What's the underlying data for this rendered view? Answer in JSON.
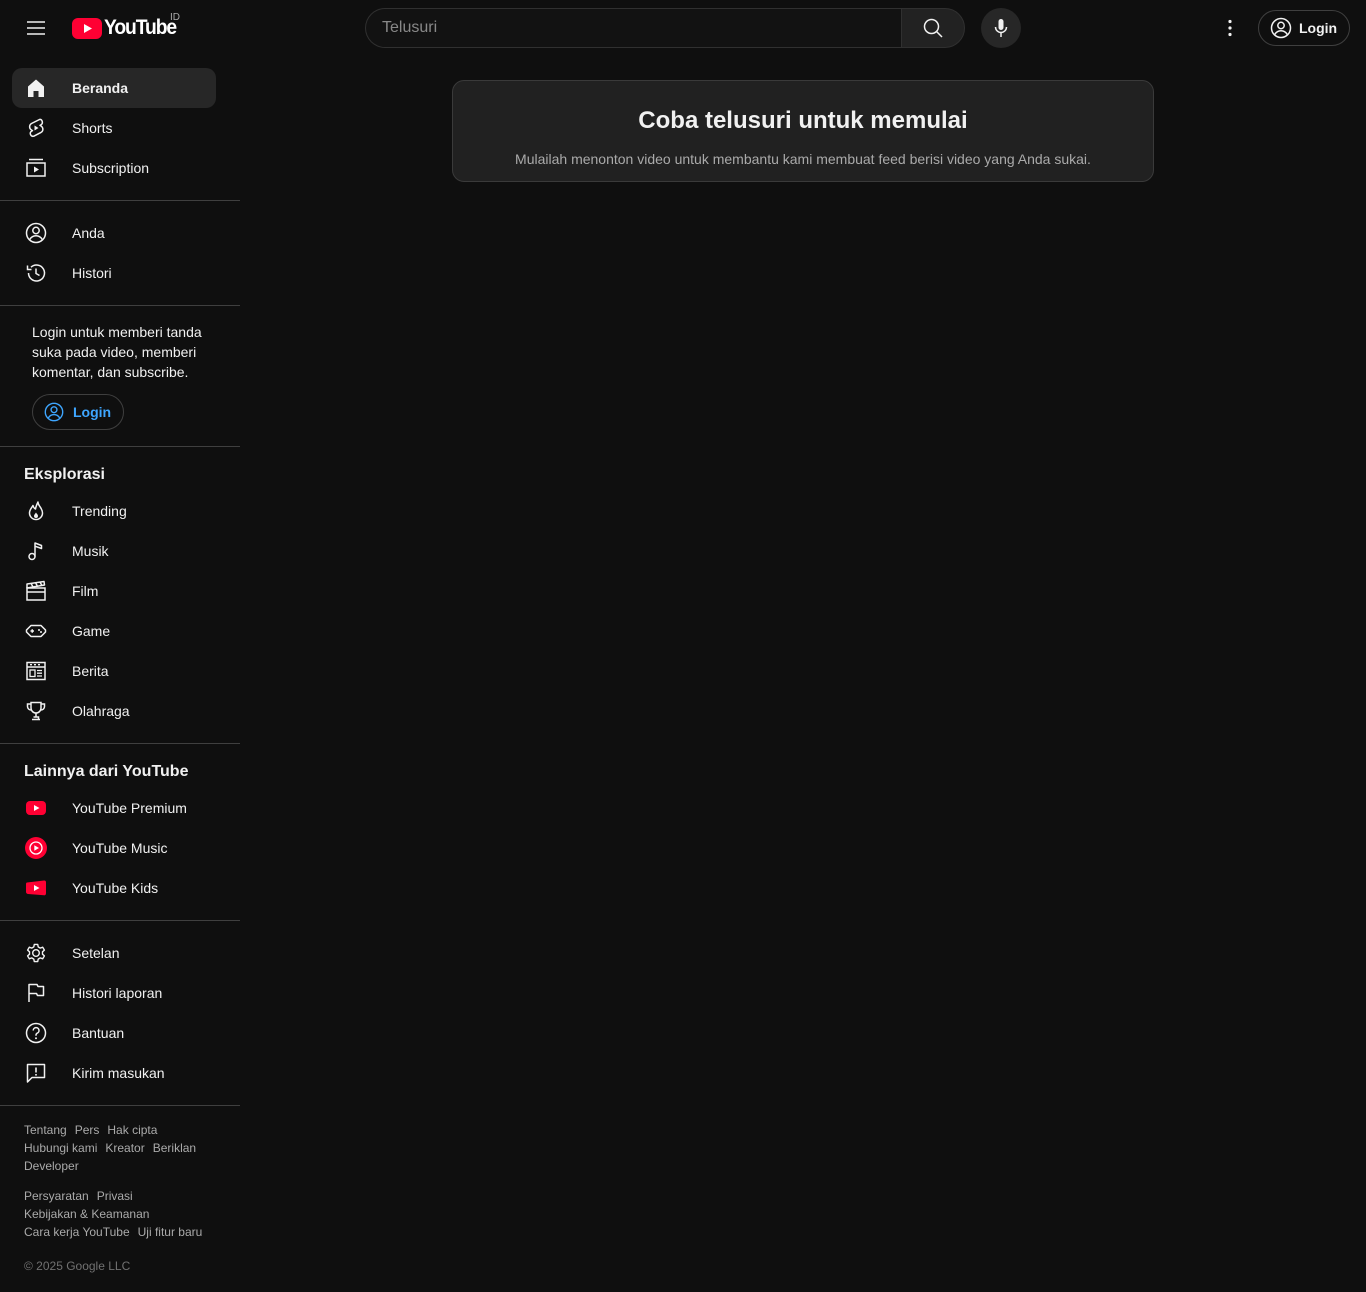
{
  "header": {
    "logo_text": "YouTube",
    "country_code": "ID",
    "search_placeholder": "Telusuri",
    "login_label": "Login"
  },
  "sidebar": {
    "main_items": [
      {
        "label": "Beranda",
        "icon": "home-icon",
        "active": true
      },
      {
        "label": "Shorts",
        "icon": "shorts-icon"
      },
      {
        "label": "Subscription",
        "icon": "subscriptions-icon"
      }
    ],
    "you_items": [
      {
        "label": "Anda",
        "icon": "account-icon"
      },
      {
        "label": "Histori",
        "icon": "history-icon"
      }
    ],
    "signin_prompt": "Login untuk memberi tanda suka pada video, memberi komentar, dan subscribe.",
    "signin_button": "Login",
    "explore_title": "Eksplorasi",
    "explore_items": [
      {
        "label": "Trending",
        "icon": "trending-icon"
      },
      {
        "label": "Musik",
        "icon": "music-icon"
      },
      {
        "label": "Film",
        "icon": "film-icon"
      },
      {
        "label": "Game",
        "icon": "gaming-icon"
      },
      {
        "label": "Berita",
        "icon": "news-icon"
      },
      {
        "label": "Olahraga",
        "icon": "sports-icon"
      }
    ],
    "more_title": "Lainnya dari YouTube",
    "more_items": [
      {
        "label": "YouTube Premium",
        "icon": "youtube-premium-icon"
      },
      {
        "label": "YouTube Music",
        "icon": "youtube-music-icon"
      },
      {
        "label": "YouTube Kids",
        "icon": "youtube-kids-icon"
      }
    ],
    "settings_items": [
      {
        "label": "Setelan",
        "icon": "settings-icon"
      },
      {
        "label": "Histori laporan",
        "icon": "flag-icon"
      },
      {
        "label": "Bantuan",
        "icon": "help-icon"
      },
      {
        "label": "Kirim masukan",
        "icon": "feedback-icon"
      }
    ],
    "footer_primary": [
      "Tentang",
      "Pers",
      "Hak cipta",
      "Hubungi kami",
      "Kreator",
      "Beriklan",
      "Developer"
    ],
    "footer_secondary": [
      "Persyaratan",
      "Privasi",
      "Kebijakan & Keamanan",
      "Cara kerja YouTube",
      "Uji fitur baru"
    ],
    "copyright": "© 2025 Google LLC"
  },
  "main": {
    "prompt_title": "Coba telusuri untuk memulai",
    "prompt_subtitle": "Mulailah menonton video untuk membantu kami membuat feed berisi video yang Anda sukai."
  },
  "colors": {
    "background": "#0f0f0f",
    "brand_red": "#ff0033",
    "link_blue": "#3ea6ff"
  }
}
